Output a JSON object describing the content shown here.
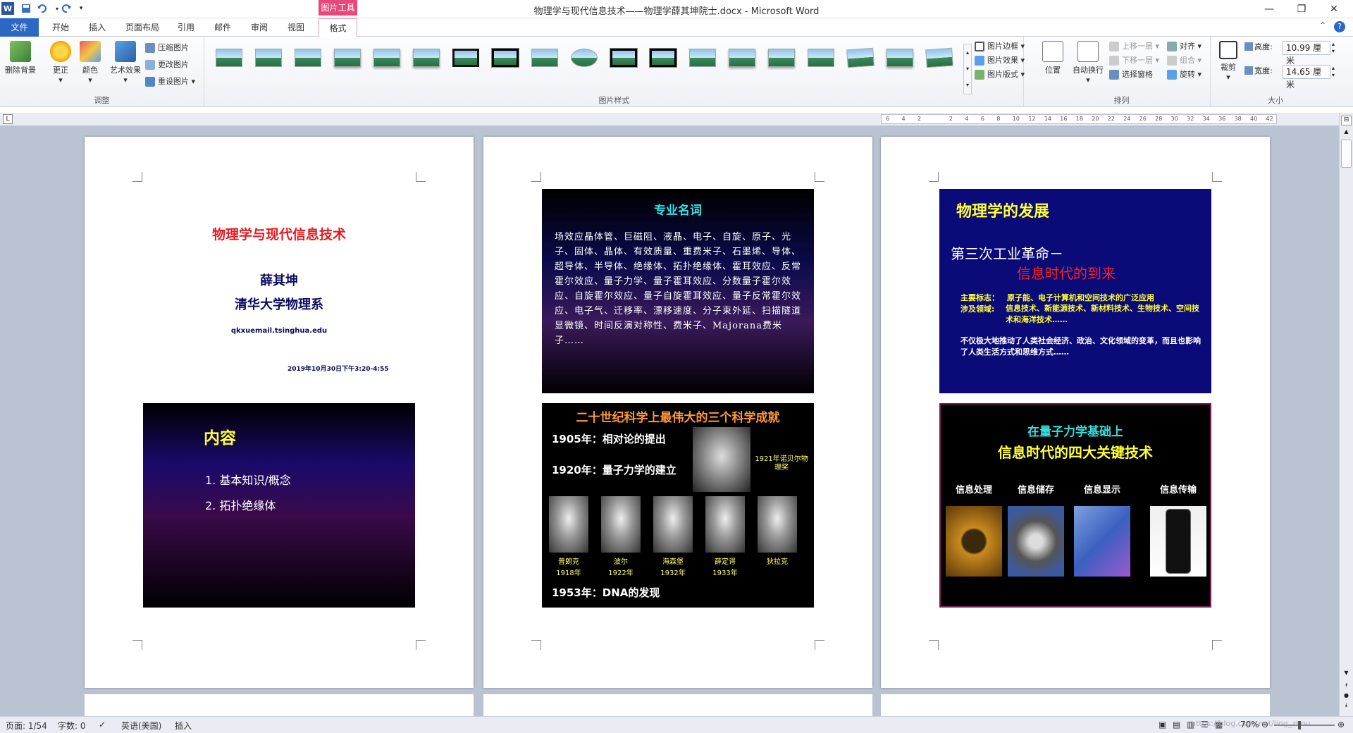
{
  "window": {
    "title": "物理学与现代信息技术——物理学薛其坤院士.docx - Microsoft Word",
    "tool_context_tab": "图片工具"
  },
  "tabs": [
    {
      "label": "文件"
    },
    {
      "label": "开始"
    },
    {
      "label": "插入"
    },
    {
      "label": "页面布局"
    },
    {
      "label": "引用"
    },
    {
      "label": "邮件"
    },
    {
      "label": "审阅"
    },
    {
      "label": "视图"
    },
    {
      "label": "格式"
    }
  ],
  "ribbon": {
    "adjust": {
      "label": "调整",
      "remove_bg": "删除背景",
      "corrections": "更正",
      "color": "颜色",
      "artistic": "艺术效果",
      "compress": "压缩图片",
      "change": "更改图片",
      "reset": "重设图片"
    },
    "styles": {
      "label": "图片样式",
      "border": "图片边框",
      "effects": "图片效果",
      "layout": "图片版式"
    },
    "arrange": {
      "label": "排列",
      "position": "位置",
      "wrap": "自动换行",
      "forward": "上移一层",
      "backward": "下移一层",
      "selection": "选择窗格",
      "align": "对齐",
      "group": "组合",
      "rotate": "旋转"
    },
    "size": {
      "label": "大小",
      "crop": "裁剪",
      "height_label": "高度:",
      "height_value": "10.99 厘米",
      "width_label": "宽度:",
      "width_value": "14.65 厘米"
    }
  },
  "ruler": {
    "ticks": [
      "6",
      "4",
      "2",
      "",
      "2",
      "4",
      "6",
      "8",
      "10",
      "12",
      "14",
      "16",
      "18",
      "20",
      "22",
      "24",
      "26",
      "28",
      "30",
      "32",
      "34",
      "36",
      "38",
      "40",
      "42"
    ]
  },
  "pages": {
    "p1": {
      "title": "物理学与现代信息技术",
      "author": "薛其坤",
      "dept": "清华大学物理系",
      "email": "qkxuemail.tsinghua.edu",
      "date": "2019年10月30日下午3:20-4:55",
      "slide": {
        "title": "内容",
        "items": [
          "1.  基本知识/概念",
          "2.  拓扑绝缘体"
        ]
      }
    },
    "p2": {
      "slide1": {
        "title": "专业名词",
        "body": "场效应晶体管、巨磁阻、液晶、电子、自旋、原子、光子、固体、晶体、有效质量、重费米子、石墨烯、导体、超导体、半导体、绝缘体、拓扑绝缘体、霍耳效应、反常霍尔效应、量子力学、量子霍耳效应、分数量子霍尔效应、自旋霍尔效应、量子自旋霍耳效应、量子反常霍尔效应、电子气、迁移率、漂移速度、分子束外延、扫描隧道显微镜、时间反演对称性、费米子、Majorana费米子……"
      },
      "slide2": {
        "title": "二十世纪科学上最伟大的三个科学成就",
        "line1": "1905年：相对论的提出",
        "line2": "1920年：量子力学的建立",
        "nobel": "1921年诺贝尔物理奖",
        "line3": "1953年：DNA的发现",
        "people": [
          {
            "name": "普朗克",
            "year": "1918年"
          },
          {
            "name": "波尔",
            "year": "1922年"
          },
          {
            "name": "海森堡",
            "year": "1932年"
          },
          {
            "name": "薛定谔",
            "year": "1933年"
          },
          {
            "name": "狄拉克",
            "year": ""
          }
        ]
      }
    },
    "p3": {
      "slide1": {
        "title": "物理学的发展",
        "subtitle": "第三次工业革命－",
        "subtitle2": "信息时代的到来",
        "mark_label": "主要标志：",
        "mark_text": "原子能、电子计算机和空间技术的广泛应用",
        "field_label": "涉及领域:",
        "field_text": "信息技术、新能源技术、新材料技术、生物技术、空间技术和海洋技术……",
        "impact": "不仅极大地推动了人类社会经济、政治、文化领域的变革，而且也影响了人类生活方式和思维方式……"
      },
      "slide2": {
        "title1": "在量子力学基础上",
        "title2": "信息时代的四大关键技术",
        "techs": [
          "信息处理",
          "信息储存",
          "信息显示",
          "信息传输"
        ]
      }
    }
  },
  "status": {
    "page": "页面: 1/54",
    "words": "字数: 0",
    "lang": "英语(美国)",
    "mode": "插入",
    "zoom": "70%",
    "watermark": "https://blog.csdn.net/ling_zhou"
  },
  "colors": {
    "accent": "#2b67c4",
    "tool_tab": "#e7487c",
    "slide_title_red": "#e8191f",
    "slide_navy": "#0a0a78"
  }
}
